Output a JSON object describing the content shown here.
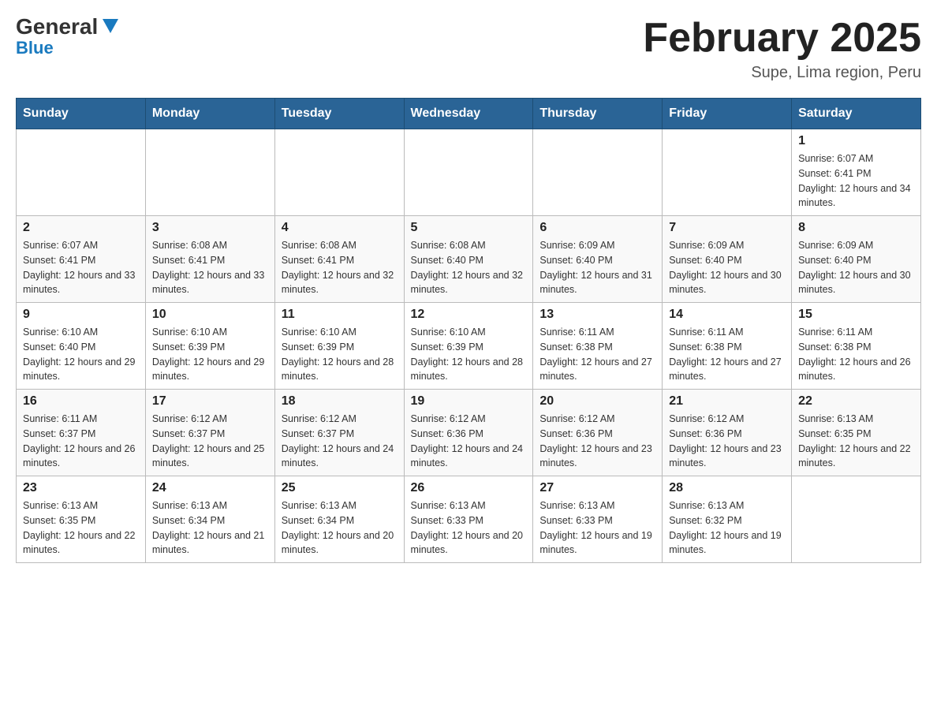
{
  "header": {
    "logo_general": "General",
    "logo_blue": "Blue",
    "month_year": "February 2025",
    "location": "Supe, Lima region, Peru"
  },
  "days_of_week": [
    "Sunday",
    "Monday",
    "Tuesday",
    "Wednesday",
    "Thursday",
    "Friday",
    "Saturday"
  ],
  "weeks": [
    [
      {
        "day": null,
        "info": null
      },
      {
        "day": null,
        "info": null
      },
      {
        "day": null,
        "info": null
      },
      {
        "day": null,
        "info": null
      },
      {
        "day": null,
        "info": null
      },
      {
        "day": null,
        "info": null
      },
      {
        "day": "1",
        "info": "Sunrise: 6:07 AM\nSunset: 6:41 PM\nDaylight: 12 hours and 34 minutes."
      }
    ],
    [
      {
        "day": "2",
        "info": "Sunrise: 6:07 AM\nSunset: 6:41 PM\nDaylight: 12 hours and 33 minutes."
      },
      {
        "day": "3",
        "info": "Sunrise: 6:08 AM\nSunset: 6:41 PM\nDaylight: 12 hours and 33 minutes."
      },
      {
        "day": "4",
        "info": "Sunrise: 6:08 AM\nSunset: 6:41 PM\nDaylight: 12 hours and 32 minutes."
      },
      {
        "day": "5",
        "info": "Sunrise: 6:08 AM\nSunset: 6:40 PM\nDaylight: 12 hours and 32 minutes."
      },
      {
        "day": "6",
        "info": "Sunrise: 6:09 AM\nSunset: 6:40 PM\nDaylight: 12 hours and 31 minutes."
      },
      {
        "day": "7",
        "info": "Sunrise: 6:09 AM\nSunset: 6:40 PM\nDaylight: 12 hours and 30 minutes."
      },
      {
        "day": "8",
        "info": "Sunrise: 6:09 AM\nSunset: 6:40 PM\nDaylight: 12 hours and 30 minutes."
      }
    ],
    [
      {
        "day": "9",
        "info": "Sunrise: 6:10 AM\nSunset: 6:40 PM\nDaylight: 12 hours and 29 minutes."
      },
      {
        "day": "10",
        "info": "Sunrise: 6:10 AM\nSunset: 6:39 PM\nDaylight: 12 hours and 29 minutes."
      },
      {
        "day": "11",
        "info": "Sunrise: 6:10 AM\nSunset: 6:39 PM\nDaylight: 12 hours and 28 minutes."
      },
      {
        "day": "12",
        "info": "Sunrise: 6:10 AM\nSunset: 6:39 PM\nDaylight: 12 hours and 28 minutes."
      },
      {
        "day": "13",
        "info": "Sunrise: 6:11 AM\nSunset: 6:38 PM\nDaylight: 12 hours and 27 minutes."
      },
      {
        "day": "14",
        "info": "Sunrise: 6:11 AM\nSunset: 6:38 PM\nDaylight: 12 hours and 27 minutes."
      },
      {
        "day": "15",
        "info": "Sunrise: 6:11 AM\nSunset: 6:38 PM\nDaylight: 12 hours and 26 minutes."
      }
    ],
    [
      {
        "day": "16",
        "info": "Sunrise: 6:11 AM\nSunset: 6:37 PM\nDaylight: 12 hours and 26 minutes."
      },
      {
        "day": "17",
        "info": "Sunrise: 6:12 AM\nSunset: 6:37 PM\nDaylight: 12 hours and 25 minutes."
      },
      {
        "day": "18",
        "info": "Sunrise: 6:12 AM\nSunset: 6:37 PM\nDaylight: 12 hours and 24 minutes."
      },
      {
        "day": "19",
        "info": "Sunrise: 6:12 AM\nSunset: 6:36 PM\nDaylight: 12 hours and 24 minutes."
      },
      {
        "day": "20",
        "info": "Sunrise: 6:12 AM\nSunset: 6:36 PM\nDaylight: 12 hours and 23 minutes."
      },
      {
        "day": "21",
        "info": "Sunrise: 6:12 AM\nSunset: 6:36 PM\nDaylight: 12 hours and 23 minutes."
      },
      {
        "day": "22",
        "info": "Sunrise: 6:13 AM\nSunset: 6:35 PM\nDaylight: 12 hours and 22 minutes."
      }
    ],
    [
      {
        "day": "23",
        "info": "Sunrise: 6:13 AM\nSunset: 6:35 PM\nDaylight: 12 hours and 22 minutes."
      },
      {
        "day": "24",
        "info": "Sunrise: 6:13 AM\nSunset: 6:34 PM\nDaylight: 12 hours and 21 minutes."
      },
      {
        "day": "25",
        "info": "Sunrise: 6:13 AM\nSunset: 6:34 PM\nDaylight: 12 hours and 20 minutes."
      },
      {
        "day": "26",
        "info": "Sunrise: 6:13 AM\nSunset: 6:33 PM\nDaylight: 12 hours and 20 minutes."
      },
      {
        "day": "27",
        "info": "Sunrise: 6:13 AM\nSunset: 6:33 PM\nDaylight: 12 hours and 19 minutes."
      },
      {
        "day": "28",
        "info": "Sunrise: 6:13 AM\nSunset: 6:32 PM\nDaylight: 12 hours and 19 minutes."
      },
      {
        "day": null,
        "info": null
      }
    ]
  ]
}
